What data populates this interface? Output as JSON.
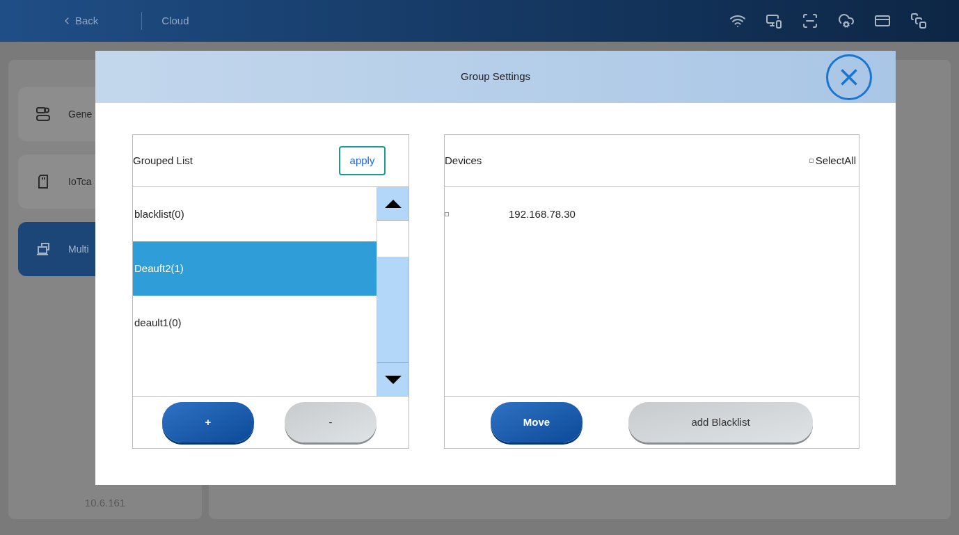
{
  "top_bar": {
    "back": "Back",
    "title": "Cloud"
  },
  "sidebar": {
    "items": [
      {
        "label": "Gene",
        "selected": false
      },
      {
        "label": "IoTca",
        "selected": false
      },
      {
        "label": "Multi",
        "selected": true
      }
    ],
    "version": "10.6.161"
  },
  "dialog": {
    "title": "Group Settings",
    "grouped_list": {
      "title": "Grouped List",
      "apply": "apply",
      "items": [
        {
          "label": "blacklist(0)",
          "selected": false
        },
        {
          "label": "Deauft2(1)",
          "selected": true
        },
        {
          "label": "deault1(0)",
          "selected": false
        }
      ],
      "buttons": [
        {
          "label": "+",
          "kind": "primary"
        },
        {
          "label": "-",
          "kind": "secondary"
        }
      ]
    },
    "devices": {
      "title": "Devices",
      "select_all": {
        "label": "SelectAll",
        "checked": false
      },
      "items": [
        {
          "label": "192.168.78.30",
          "checked": false
        }
      ],
      "buttons": [
        {
          "label": "Move",
          "kind": "primary"
        },
        {
          "label": "add Blacklist",
          "kind": "secondary"
        }
      ]
    }
  }
}
